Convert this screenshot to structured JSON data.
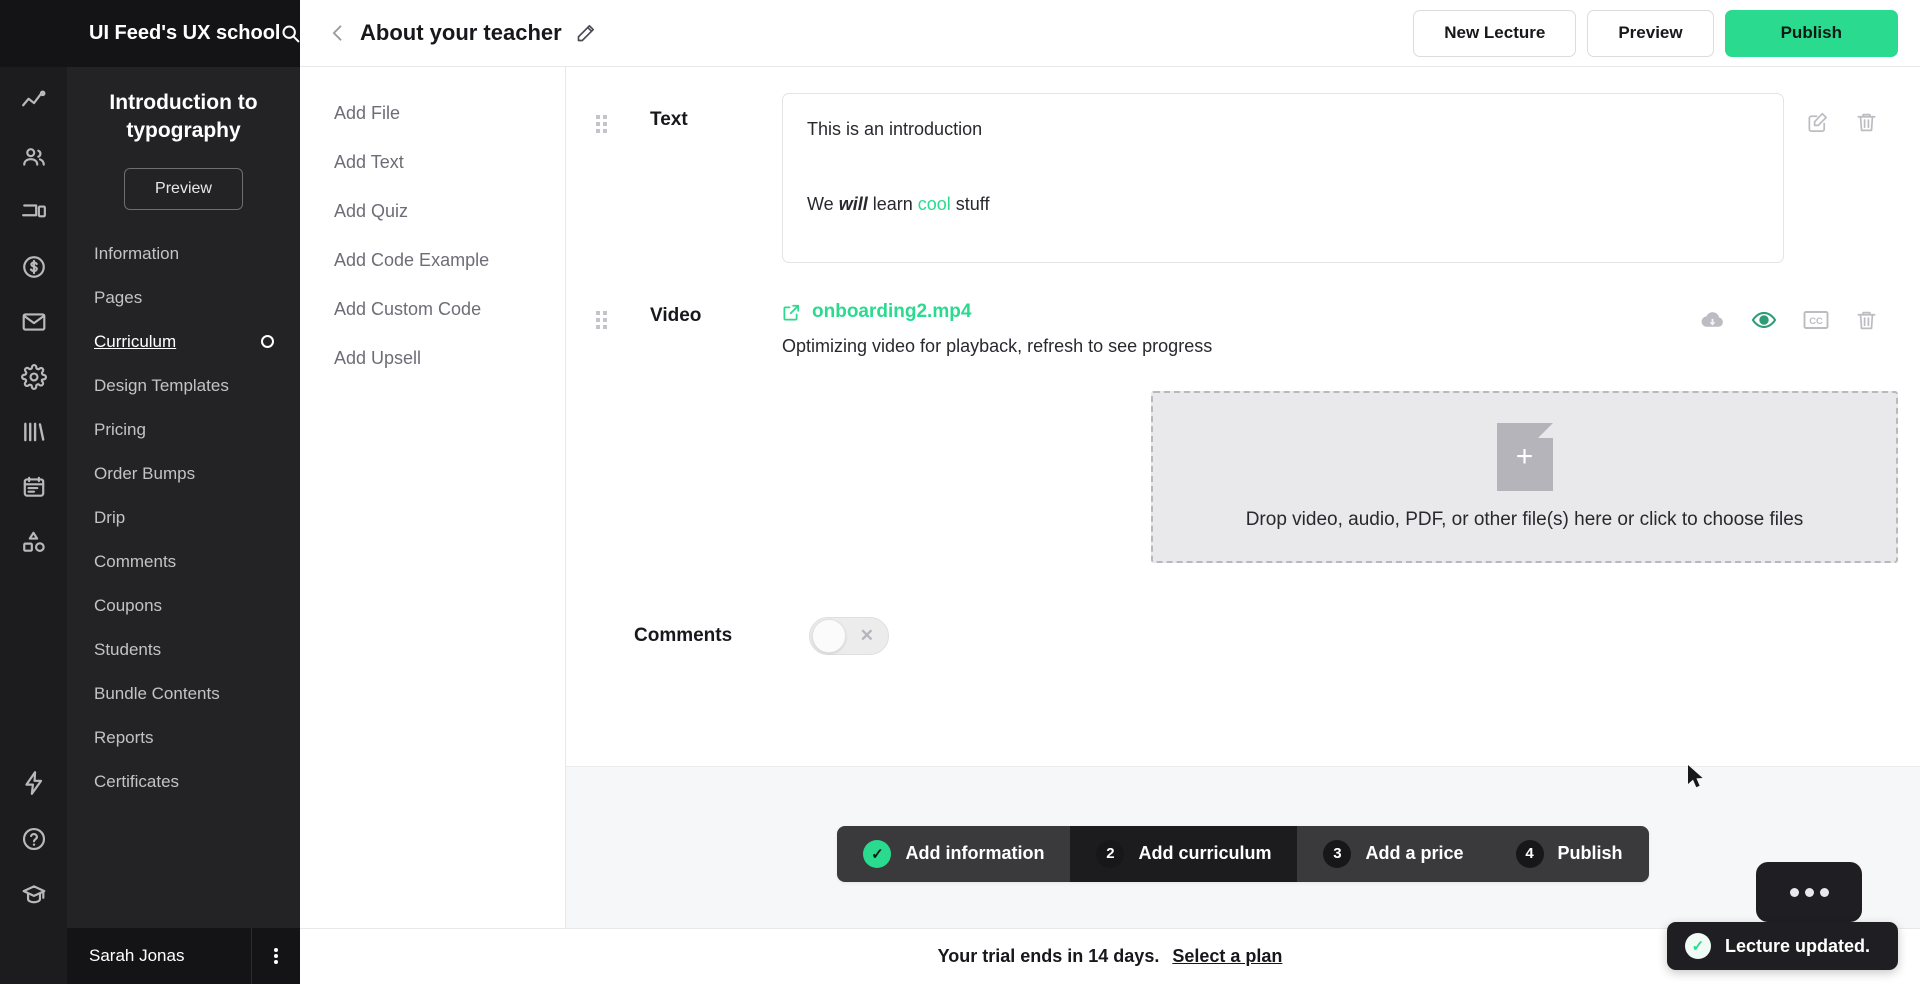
{
  "brand": {
    "name": "UI Feed's UX school",
    "search_icon": "search-icon"
  },
  "rail": {
    "icons": [
      {
        "name": "analytics-icon"
      },
      {
        "name": "people-icon"
      },
      {
        "name": "devices-icon"
      },
      {
        "name": "dollar-coin-icon"
      },
      {
        "name": "mail-icon"
      },
      {
        "name": "gear-icon"
      },
      {
        "name": "library-books-icon"
      },
      {
        "name": "calendar-icon"
      },
      {
        "name": "shapes-icon"
      }
    ],
    "bottom_icons": [
      {
        "name": "lightning-icon"
      },
      {
        "name": "help-circle-icon"
      },
      {
        "name": "graduation-cap-icon"
      }
    ]
  },
  "sidebar": {
    "course_title": "Introduction to typography",
    "preview_label": "Preview",
    "items": [
      {
        "label": "Information",
        "active": false,
        "external": false,
        "dot": false
      },
      {
        "label": "Pages",
        "active": false,
        "external": false,
        "dot": false
      },
      {
        "label": "Curriculum",
        "active": true,
        "external": false,
        "dot": true
      },
      {
        "label": "Design Templates",
        "active": false,
        "external": false,
        "dot": false
      },
      {
        "label": "Pricing",
        "active": false,
        "external": false,
        "dot": false
      },
      {
        "label": "Order Bumps",
        "active": false,
        "external": false,
        "dot": false
      },
      {
        "label": "Drip",
        "active": false,
        "external": false,
        "dot": false
      },
      {
        "label": "Comments",
        "active": false,
        "external": false,
        "dot": false
      },
      {
        "label": "Coupons",
        "active": false,
        "external": false,
        "dot": false
      },
      {
        "label": "Students",
        "active": false,
        "external": true,
        "dot": false
      },
      {
        "label": "Bundle Contents",
        "active": false,
        "external": false,
        "dot": false
      },
      {
        "label": "Reports",
        "active": false,
        "external": false,
        "dot": false
      },
      {
        "label": "Certificates",
        "active": false,
        "external": false,
        "dot": false
      }
    ],
    "user_name": "Sarah Jonas"
  },
  "topbar": {
    "title": "About your teacher",
    "back_icon": "chevron-left-icon",
    "edit_icon": "pencil-icon",
    "new_lecture_label": "New Lecture",
    "preview_label": "Preview",
    "publish_label": "Publish"
  },
  "add_panel": {
    "items": [
      {
        "label": "Add File"
      },
      {
        "label": "Add Text"
      },
      {
        "label": "Add Quiz"
      },
      {
        "label": "Add Code Example"
      },
      {
        "label": "Add Custom Code"
      },
      {
        "label": "Add Upsell"
      }
    ]
  },
  "blocks": {
    "text": {
      "label": "Text",
      "line1": "This is an introduction",
      "line2_pre": "We ",
      "line2_bold": "will",
      "line2_mid": " learn ",
      "line2_green": "cool",
      "line2_post": " stuff",
      "actions": [
        {
          "name": "edit-icon"
        },
        {
          "name": "trash-icon"
        }
      ]
    },
    "video": {
      "label": "Video",
      "file_name": "onboarding2.mp4",
      "status": "Optimizing video for playback, refresh to see progress",
      "actions": [
        {
          "name": "download-cloud-icon"
        },
        {
          "name": "eye-icon"
        },
        {
          "name": "closed-caption-icon"
        },
        {
          "name": "trash-icon"
        }
      ]
    },
    "dropzone": {
      "text": "Drop video, audio, PDF, or other file(s) here or click to choose files"
    },
    "comments": {
      "label": "Comments",
      "enabled": false
    }
  },
  "steps": [
    {
      "badge": "✓",
      "label": "Add information",
      "state": "done"
    },
    {
      "badge": "2",
      "label": "Add curriculum",
      "state": "active"
    },
    {
      "badge": "3",
      "label": "Add a price",
      "state": "pending"
    },
    {
      "badge": "4",
      "label": "Publish",
      "state": "pending"
    }
  ],
  "trial": {
    "message": "Your trial ends in 14 days.",
    "link_label": "Select a plan"
  },
  "toast": {
    "message": "Lecture updated.",
    "icon": "check-circle-icon"
  },
  "colors": {
    "accent_green": "#2ADA8E",
    "sidebar_dark": "#232326",
    "rail_dark": "#1C1C1E"
  }
}
